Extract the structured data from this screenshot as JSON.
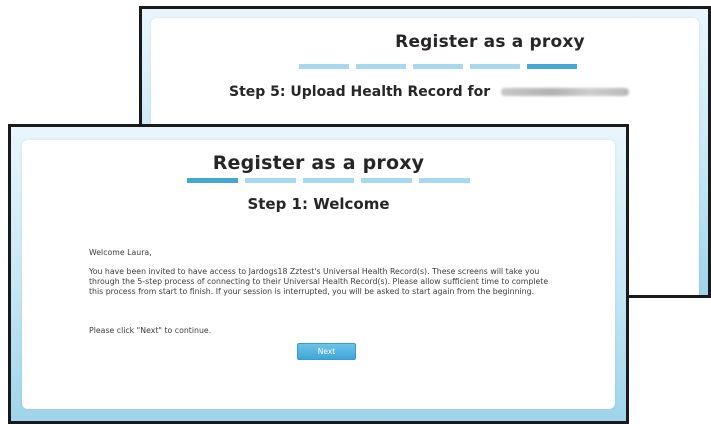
{
  "back_window": {
    "title": "Register as a proxy",
    "step_title": "Step 5: Upload Health Record for",
    "progress": {
      "total_steps": 5,
      "current_step": 5
    }
  },
  "front_window": {
    "title": "Register as a proxy",
    "step_title": "Step 1: Welcome",
    "progress": {
      "total_steps": 5,
      "current_step": 1
    },
    "greeting": "Welcome Laura,",
    "paragraph": "You have been invited to have access to Jardogs18 Zztest's Universal Health Record(s). These screens will take you through the 5-step process of connecting to their Universal Health Record(s). Please allow sufficient time to complete this process from start to finish. If your session is interrupted, you will be asked to start again from the beginning.",
    "instruction": "Please click \"Next\" to continue.",
    "next_button_label": "Next"
  },
  "colors": {
    "progress_active": "#46a6d5",
    "progress_inactive": "#a9d7ef",
    "button": "#3fa6d8",
    "window_border": "#1a1a1a"
  }
}
